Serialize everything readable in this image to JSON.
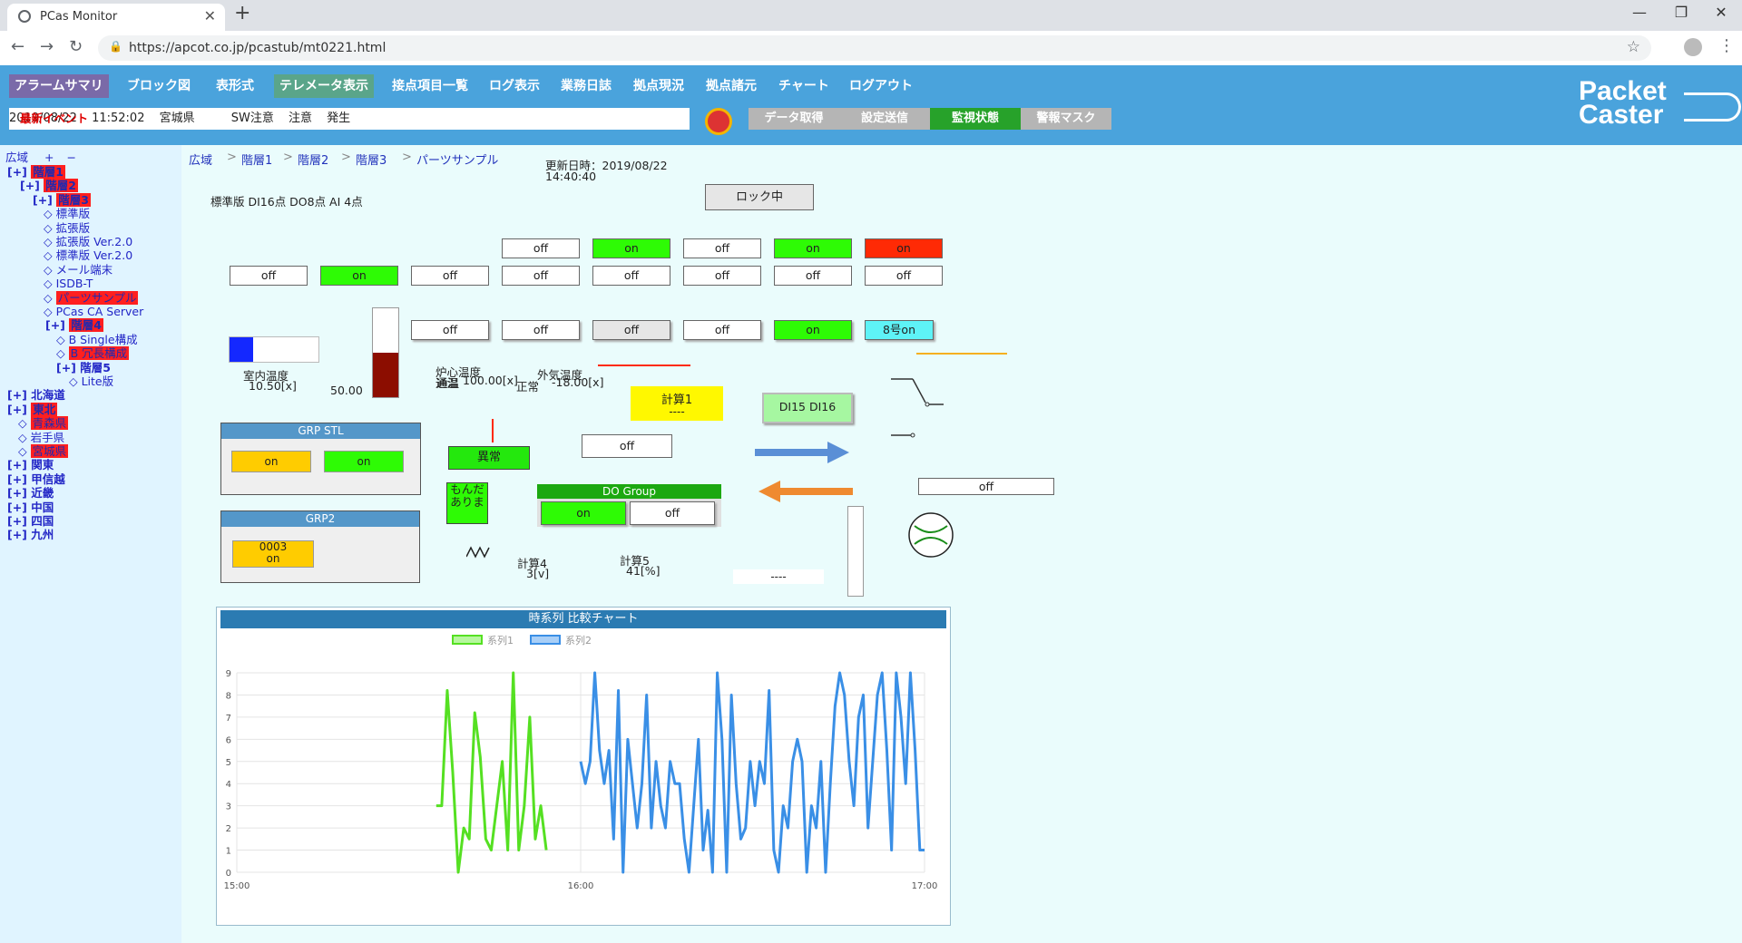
{
  "browser": {
    "tab_title": "PCas Monitor",
    "url": "https://apcot.co.jp/pcastub/mt0221.html"
  },
  "menu": [
    "アラームサマリ",
    "ブロック図",
    "表形式",
    "テレメータ表示",
    "接点項目一覧",
    "ログ表示",
    "業務日誌",
    "拠点現況",
    "拠点諸元",
    "チャート",
    "ログアウト"
  ],
  "event": {
    "label": "最新イベント",
    "date": "2019/08/22",
    "time": "11:52:02",
    "area": "宮城県",
    "type": "SW注意",
    "level": "注意",
    "state": "発生"
  },
  "modes": [
    "データ取得",
    "設定送信",
    "監視状態",
    "警報マスク"
  ],
  "logo": {
    "line1": "Packet",
    "line2": "Caster"
  },
  "tree": {
    "root": "広域",
    "plus": "+",
    "minus": "−",
    "items": [
      {
        "prefix": "[+]",
        "label": "階層1",
        "hl": true
      },
      {
        "prefix": "[+]",
        "label": "階層2",
        "hl": true
      },
      {
        "prefix": "[+]",
        "label": "階層3",
        "hl": true
      },
      {
        "prefix": "◇",
        "label": "標準版"
      },
      {
        "prefix": "◇",
        "label": "拡張版"
      },
      {
        "prefix": "◇",
        "label": "拡張版 Ver.2.0"
      },
      {
        "prefix": "◇",
        "label": "標準版 Ver.2.0"
      },
      {
        "prefix": "◇",
        "label": "メール端末"
      },
      {
        "prefix": "◇",
        "label": "ISDB-T"
      },
      {
        "prefix": "◇",
        "label": "パーツサンプル",
        "hl": true
      },
      {
        "prefix": "◇",
        "label": "PCas CA Server"
      },
      {
        "prefix": "[+]",
        "label": "階層4",
        "hl": true
      },
      {
        "prefix": "◇",
        "label": "B Single構成"
      },
      {
        "prefix": "◇",
        "label": "B 冗長構成",
        "hl": true
      },
      {
        "prefix": "[+]",
        "label": "階層5"
      },
      {
        "prefix": "◇",
        "label": "Lite版"
      },
      {
        "prefix": "[+]",
        "label": "北海道"
      },
      {
        "prefix": "[+]",
        "label": "東北",
        "hl": true
      },
      {
        "prefix": "◇",
        "label": "青森県",
        "hl": true
      },
      {
        "prefix": "◇",
        "label": "岩手県"
      },
      {
        "prefix": "◇",
        "label": "宮城県",
        "hl": true
      },
      {
        "prefix": "[+]",
        "label": "関東"
      },
      {
        "prefix": "[+]",
        "label": "甲信越"
      },
      {
        "prefix": "[+]",
        "label": "近畿"
      },
      {
        "prefix": "[+]",
        "label": "中国"
      },
      {
        "prefix": "[+]",
        "label": "四国"
      },
      {
        "prefix": "[+]",
        "label": "九州"
      }
    ]
  },
  "breadcrumb": [
    "広域",
    "階層1",
    "階層2",
    "階層3",
    "パーツサンプル"
  ],
  "breadcrumb_sep": ">",
  "updated": {
    "label": "更新日時：2019/08/22",
    "time": "14:40:40"
  },
  "lock_button": "ロック中",
  "model_label": "標準版 DI16点 DO8点 AI 4点",
  "row1": [
    "off",
    "on",
    "off",
    "on",
    "on"
  ],
  "row2": [
    "off",
    "on",
    "off",
    "off",
    "off",
    "off",
    "off",
    "off"
  ],
  "row3": [
    "off",
    "off",
    "off",
    "off",
    "on",
    "8号on"
  ],
  "gauges": {
    "room_label": "室内温度",
    "room_value": "10.50[x]",
    "bar_value": "50.00",
    "core_label": "炉心温度",
    "core_status": "通温",
    "core_value": "100.00[x]",
    "outside_label": "外気温度",
    "outside_status": "正常",
    "outside_value": "-18.00[x]"
  },
  "calc1": {
    "label": "計算1",
    "value": "----"
  },
  "di_button": "DI15 DI16",
  "abnormal": "異常",
  "off_box": "off",
  "off_box2": "off",
  "problem": "もんだありま",
  "grp_stl": {
    "title": "GRP STL",
    "b1": "on",
    "b2": "on"
  },
  "grp2": {
    "title": "GRP2",
    "line1": "0003",
    "line2": "on"
  },
  "do_group": {
    "title": "DO Group",
    "on": "on",
    "off": "off"
  },
  "calc4": {
    "label": "計算4",
    "value": "3[v]"
  },
  "calc5": {
    "label": "計算5",
    "value": "41[%]"
  },
  "dash_value": "----",
  "colors": {
    "header": "#4aa3dc",
    "green": "#2efb05",
    "red": "#ff2a05",
    "series1": "#55e022",
    "series2": "#3a8fe6"
  },
  "chart_data": {
    "type": "line",
    "title": "時系列 比較チャート",
    "x": [
      "15:00",
      "16:00",
      "17:00"
    ],
    "ylim": [
      0,
      9
    ],
    "yticks": [
      0,
      1,
      2,
      3,
      4,
      5,
      6,
      7,
      8,
      9
    ],
    "series": [
      {
        "name": "系列1",
        "values": [
          3,
          3,
          8.2,
          4.5,
          0,
          2,
          1.5,
          7.2,
          5.2,
          1.5,
          1,
          3,
          5,
          1,
          9,
          1,
          3,
          7,
          1.5,
          3,
          1
        ]
      },
      {
        "name": "系列2",
        "values": [
          5,
          4,
          5,
          9,
          5.5,
          4,
          5.5,
          1.5,
          8.2,
          0,
          6,
          4,
          2,
          4,
          8,
          2,
          5,
          3,
          2,
          5,
          4,
          4,
          1.5,
          0,
          3,
          6,
          1,
          2.8,
          0,
          9,
          6,
          0,
          8,
          4,
          1.5,
          2,
          5,
          3,
          5,
          4,
          8.2,
          1,
          0,
          3,
          2,
          5,
          6,
          5,
          0,
          3,
          2,
          5,
          0,
          4,
          7.5,
          9,
          8,
          5,
          3,
          7,
          8,
          2,
          5,
          8,
          9,
          5.5,
          1,
          9,
          7,
          4,
          9,
          5.5,
          1,
          1
        ]
      }
    ],
    "series_x_index": [
      [
        0.58,
        0.9
      ],
      [
        1.0,
        2.0
      ]
    ]
  }
}
